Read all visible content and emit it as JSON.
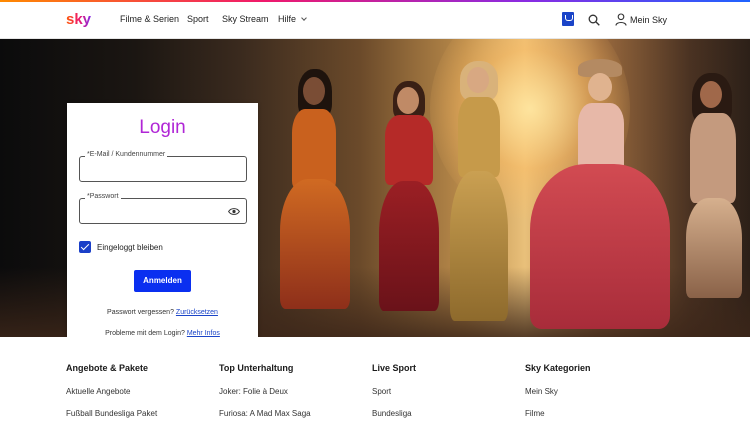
{
  "header": {
    "logo_icon": "sky-logo",
    "nav": [
      "Filme & Serien",
      "Sport",
      "Sky Stream",
      "Hilfe"
    ],
    "my_sky": "Mein Sky"
  },
  "login": {
    "title": "Login",
    "email_label": "*E-Mail / Kundennummer",
    "email_value": "",
    "password_label": "*Passwort",
    "password_value": "",
    "remember_label": "Eingeloggt bleiben",
    "remember_checked": true,
    "submit": "Anmelden",
    "forgot_text": "Passwort vergessen?",
    "forgot_link": "Zurücksetzen",
    "problem_text": "Probleme mit dem Login?",
    "problem_link": "Mehr Infos"
  },
  "footer": {
    "columns": [
      {
        "title": "Angebote & Pakete",
        "items": [
          "Aktuelle Angebote",
          "Fußball Bundesliga Paket"
        ]
      },
      {
        "title": "Top Unterhaltung",
        "items": [
          "Joker: Folie à Deux",
          "Furiosa: A Mad Max Saga"
        ]
      },
      {
        "title": "Live Sport",
        "items": [
          "Sport",
          "Bundesliga"
        ]
      },
      {
        "title": "Sky Kategorien",
        "items": [
          "Mein Sky",
          "Filme"
        ]
      }
    ]
  },
  "colors": {
    "accent_purple": "#b026d6",
    "button_blue": "#0a2ff0",
    "link_blue": "#1a44c8"
  }
}
